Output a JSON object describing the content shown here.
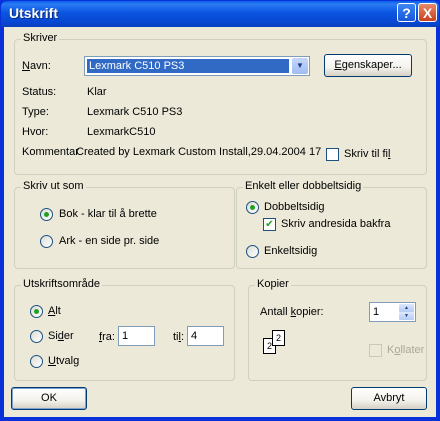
{
  "window": {
    "title": "Utskrift",
    "help": "?",
    "close": "X"
  },
  "printer": {
    "legend": "Skriver",
    "name_label_pre": "",
    "name_label_u": "N",
    "name_label_post": "avn:",
    "name_value": "Lexmark C510 PS3",
    "properties_u": "E",
    "properties_post": "genskaper...",
    "status_label": "Status:",
    "status_value": "Klar",
    "type_label": "Type:",
    "type_value": "Lexmark C510 PS3",
    "where_label": "Hvor:",
    "where_value": "LexmarkC510",
    "comment_label": "Kommentar",
    "comment_value": "Created by Lexmark Custom Install,29.04.2004 17",
    "print_to_file_pre": "Skriv til fi",
    "print_to_file_u": "l"
  },
  "print_as": {
    "legend": "Skriv ut som",
    "opt_book": "Bok - klar til å brette",
    "opt_sheet": "Ark - en side pr. side"
  },
  "duplex": {
    "legend": "Enkelt eller dobbeltsidig",
    "opt_double": "Dobbeltsidig",
    "opt_backside": "Skriv andresida bakfra",
    "opt_single": "Enkeltsidig"
  },
  "range": {
    "legend": "Utskriftsområde",
    "opt_all_u": "A",
    "opt_all_post": "lt",
    "opt_pages_pre": "Si",
    "opt_pages_u": "d",
    "opt_pages_post": "er",
    "from_u": "f",
    "from_post": "ra:",
    "from_value": "1",
    "to_pre": "ti",
    "to_u": "l",
    "to_post": ":",
    "to_value": "4",
    "opt_selection_u": "U",
    "opt_selection_post": "tvalg"
  },
  "copies": {
    "legend": "Kopier",
    "count_label_pre": "Antall ",
    "count_label_u": "k",
    "count_label_post": "opier:",
    "count_value": "1",
    "page_a": "2",
    "page_b": "2",
    "collate_pre": "K",
    "collate_u": "o",
    "collate_post": "llater"
  },
  "buttons": {
    "ok": "OK",
    "cancel": "Avbryt"
  }
}
